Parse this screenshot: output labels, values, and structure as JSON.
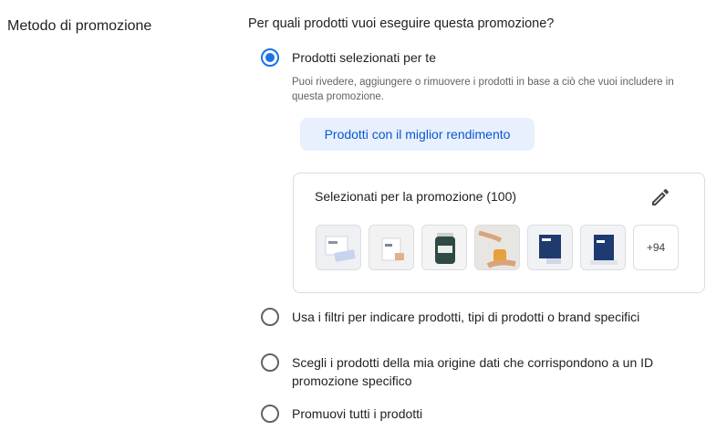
{
  "section_label": "Metodo di promozione",
  "question": "Per quali prodotti vuoi eseguire questa promozione?",
  "options": [
    {
      "label": "Prodotti selezionati per te",
      "selected": true,
      "helper": "Puoi rivedere, aggiungere o rimuovere i prodotti in base a ciò che vuoi includere in questa promozione."
    },
    {
      "label": "Usa i filtri per indicare prodotti, tipi di prodotti o brand specifici",
      "selected": false
    },
    {
      "label": "Scegli i prodotti della mia origine dati che corrispondono a un ID promozione specifico",
      "selected": false
    },
    {
      "label": "Promuovi tutti i prodotti",
      "selected": false
    }
  ],
  "chip_label": "Prodotti con il miglior rendimento",
  "selection_card": {
    "title": "Selezionati per la promozione (100)",
    "edit_icon": "pencil-icon",
    "thumbnails": [
      "product-thumbnail",
      "product-thumbnail",
      "product-thumbnail",
      "product-thumbnail",
      "product-thumbnail",
      "product-thumbnail"
    ],
    "more_label": "+94"
  },
  "colors": {
    "accent": "#1a73e8",
    "chip_bg": "#e8f0fe",
    "chip_text": "#0b57d0",
    "border": "#dadce0",
    "helper_text": "#5f6368"
  }
}
